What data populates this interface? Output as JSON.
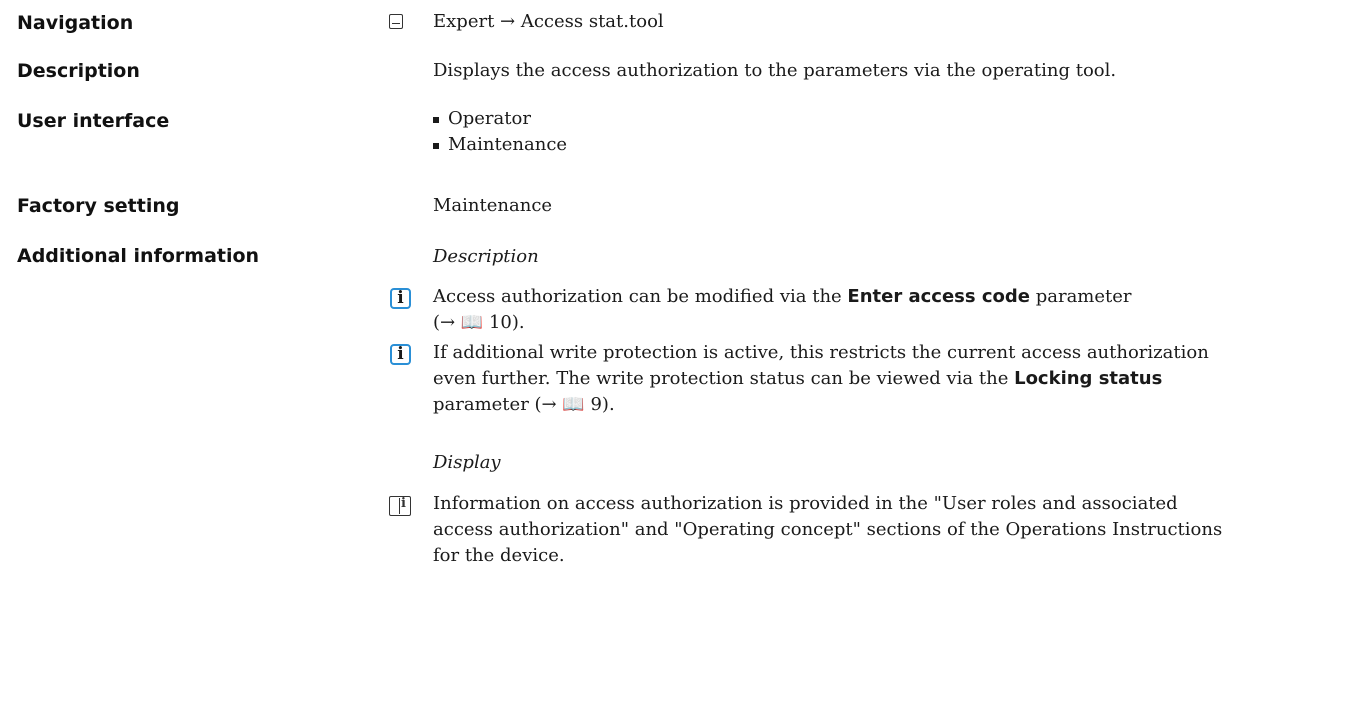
{
  "navigation": {
    "label": "Navigation",
    "icon": "menu-icon",
    "path": "Expert → Access stat.tool"
  },
  "description": {
    "label": "Description",
    "text": "Displays the access authorization to the parameters via the operating tool."
  },
  "user_interface": {
    "label": "User interface",
    "options": [
      "Operator",
      "Maintenance"
    ]
  },
  "factory_setting": {
    "label": "Factory setting",
    "value": "Maintenance"
  },
  "additional_information": {
    "label": "Additional information",
    "description_heading": "Description",
    "note1": {
      "icon": "info-icon",
      "text_before": "Access authorization can be modified via the ",
      "bold": "Enter access code",
      "text_after": " parameter",
      "ref": "(→ 📖 10)."
    },
    "note2": {
      "icon": "info-icon",
      "line1": "If additional write protection is active, this restricts the current access authorization",
      "line2_before": "even further. The write protection status can be viewed via the ",
      "bold": "Locking status",
      "line3": "parameter (→ 📖 9)."
    },
    "display_heading": "Display",
    "note3": {
      "icon": "book-icon",
      "line1": "Information on access authorization is provided in the \"User roles and associated",
      "line2": "access authorization\" and \"Operating concept\" sections of the Operations Instructions",
      "line3": "for the device."
    }
  }
}
